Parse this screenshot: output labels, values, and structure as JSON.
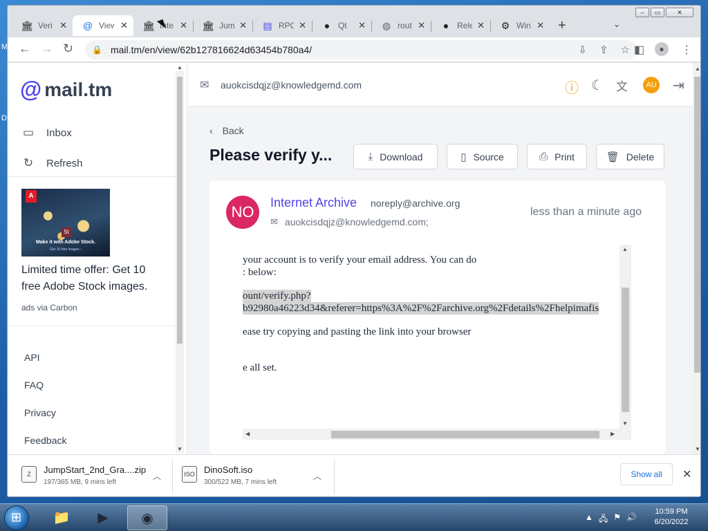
{
  "browser": {
    "tabs": [
      {
        "icon": "archive-icon",
        "title": "Veri"
      },
      {
        "icon": "at-icon",
        "title": "View"
      },
      {
        "icon": "archive-icon",
        "title": "Inte"
      },
      {
        "icon": "archive-icon",
        "title": "Jum"
      },
      {
        "icon": "document-icon",
        "title": "RPC"
      },
      {
        "icon": "github-icon",
        "title": "Qt"
      },
      {
        "icon": "globe-icon",
        "title": "rout"
      },
      {
        "icon": "github-icon",
        "title": "Rele"
      },
      {
        "icon": "gear-icon",
        "title": "Win"
      }
    ],
    "active_tab": 1,
    "url": "mail.tm/en/view/62b127816624d63454b780a4/"
  },
  "sidebar": {
    "logo": "mail.tm",
    "nav": [
      {
        "icon": "inbox-icon",
        "label": "Inbox"
      },
      {
        "icon": "refresh-icon",
        "label": "Refresh"
      }
    ],
    "ad": {
      "image_caption": "Make it with Adobe Stock.",
      "image_subcaption": "Get 10 free images ›",
      "text": "Limited time offer: Get 10 free Adobe Stock images.",
      "via": "ads via Carbon"
    },
    "footer_links": [
      "API",
      "FAQ",
      "Privacy",
      "Feedback"
    ]
  },
  "header": {
    "account": "auokcisdqjz@knowledgemd.com",
    "avatar_initials": "AU"
  },
  "message": {
    "back_label": "Back",
    "subject": "Please verify y...",
    "actions": [
      "Download",
      "Source",
      "Print",
      "Delete"
    ],
    "avatar_initials": "NO",
    "sender_name": "Internet Archive",
    "sender_email": "noreply@archive.org",
    "time": "less than a minute ago",
    "recipient": "auokcisdqjz@knowledgemd.com;",
    "body_lines": [
      "your account is to verify your email address. You can do",
      ": below:",
      "ount/verify.php?",
      "b92980a46223d34&referer=https%3A%2F%2Farchive.org%2Fdetails%2Fhelpimafis",
      "ease try copying and pasting the link into your browser",
      "e all set."
    ]
  },
  "downloads": [
    {
      "name": "JumpStart_2nd_Gra....zip",
      "progress": "197/365 MB, 9 mins left"
    },
    {
      "name": "DinoSoft.iso",
      "progress": "300/522 MB, 7 mins left"
    }
  ],
  "downloads_show_all": "Show all",
  "taskbar": {
    "time": "10:59 PM",
    "date": "6/20/2022"
  },
  "colors": {
    "brand": "#4f46e5",
    "avatar_no": "#db2763",
    "avatar_au": "#f59e0b"
  }
}
